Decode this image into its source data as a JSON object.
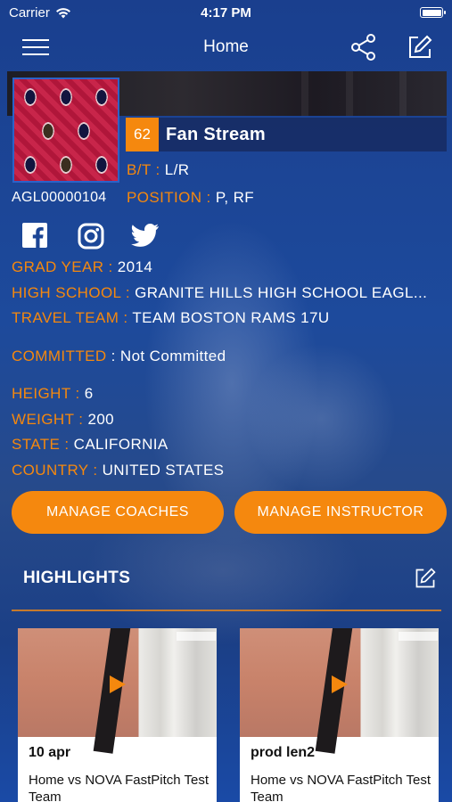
{
  "status_bar": {
    "carrier": "Carrier",
    "time": "4:17 PM"
  },
  "nav": {
    "title": "Home"
  },
  "profile": {
    "fan_count": "62",
    "fan_label": "Fan Stream",
    "player_id": "AGL00000104",
    "bt_label": "B/T :",
    "bt_value": "L/R",
    "position_label": "POSITION :",
    "position_value": "P, RF"
  },
  "details": [
    {
      "label": "GRAD YEAR :",
      "value": "2014"
    },
    {
      "label": "HIGH SCHOOL :",
      "value": "GRANITE HILLS HIGH SCHOOL EAGL..."
    },
    {
      "label": "TRAVEL TEAM :",
      "value": "TEAM BOSTON RAMS 17U"
    },
    {
      "label": "COMMITTED",
      "value": " : Not Committed"
    },
    {
      "label": "HEIGHT :",
      "value": "6"
    },
    {
      "label": "WEIGHT :",
      "value": "200"
    },
    {
      "label": "STATE :",
      "value": "CALIFORNIA"
    },
    {
      "label": "COUNTRY :",
      "value": "UNITED STATES"
    }
  ],
  "buttons": {
    "manage_coaches": "MANAGE COACHES",
    "manage_instructor": "MANAGE INSTRUCTOR"
  },
  "highlights": {
    "title": "HIGHLIGHTS",
    "cards": [
      {
        "title": "10 apr",
        "subtitle": "Home vs NOVA FastPitch Test Team"
      },
      {
        "title": "prod len2",
        "subtitle": "Home vs NOVA FastPitch Test Team"
      }
    ]
  },
  "colors": {
    "accent": "#f5880e",
    "background": "#1b4595"
  },
  "icons": [
    "wifi-icon",
    "battery-icon",
    "menu-icon",
    "share-icon",
    "edit-icon",
    "facebook-icon",
    "instagram-icon",
    "twitter-icon",
    "play-icon"
  ]
}
